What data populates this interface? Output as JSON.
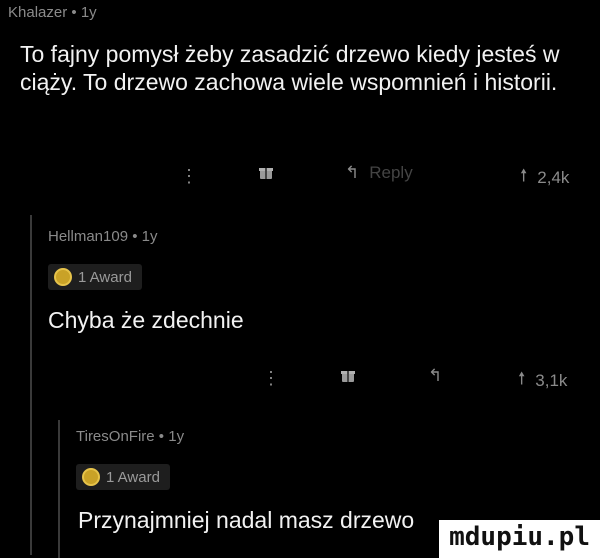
{
  "comments": [
    {
      "author": "Khalazer",
      "age": "1y",
      "text": "To fajny pomysł żeby zasadzić drzewo kiedy jesteś w ciąży. To drzewo zachowa wiele wspomnień i historii.",
      "reply_label": "Reply",
      "votes": "2,4k"
    },
    {
      "author": "Hellman109",
      "age": "1y",
      "award": "1 Award",
      "text": "Chyba że zdechnie",
      "votes": "3,1k"
    },
    {
      "author": "TiresOnFire",
      "age": "1y",
      "award": "1 Award",
      "text": "Przynajmniej nadal masz drzewo"
    }
  ],
  "separator": "•",
  "watermark": "mdupiu.pl"
}
